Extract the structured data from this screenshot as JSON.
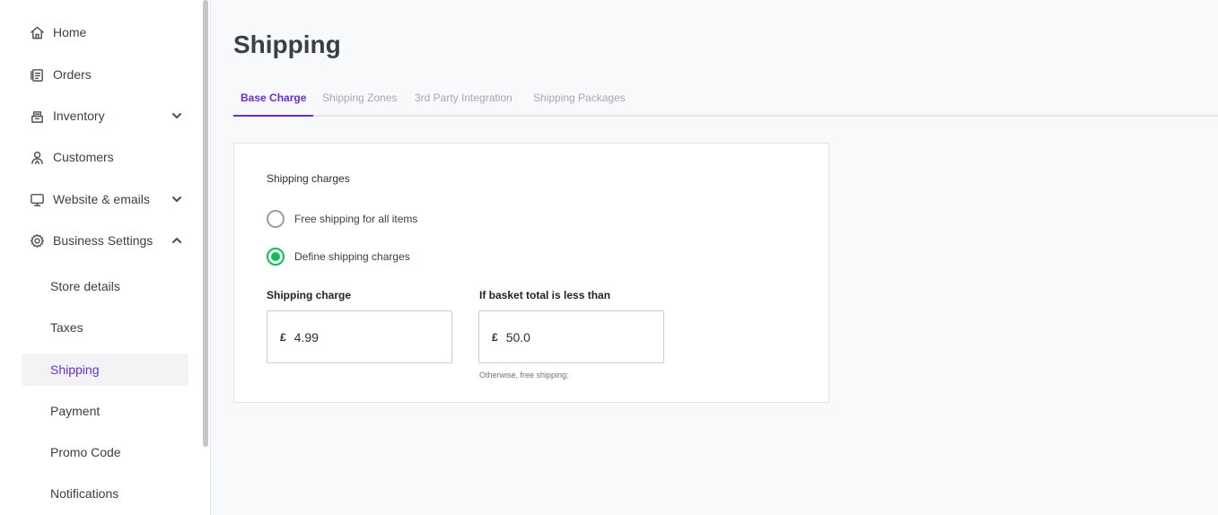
{
  "sidebar": {
    "items": [
      {
        "label": "Home",
        "icon": "home-icon"
      },
      {
        "label": "Orders",
        "icon": "orders-icon"
      },
      {
        "label": "Inventory",
        "icon": "inventory-icon"
      },
      {
        "label": "Customers",
        "icon": "customers-icon"
      },
      {
        "label": "Website & emails",
        "icon": "monitor-icon"
      },
      {
        "label": "Business Settings",
        "icon": "gear-icon"
      }
    ],
    "sub_items": [
      {
        "label": "Store details"
      },
      {
        "label": "Taxes"
      },
      {
        "label": "Shipping",
        "active": true
      },
      {
        "label": "Payment"
      },
      {
        "label": "Promo Code"
      },
      {
        "label": "Notifications"
      }
    ]
  },
  "page": {
    "title": "Shipping"
  },
  "tabs": [
    {
      "label": "Base Charge",
      "active": true
    },
    {
      "label": "Shipping Zones"
    },
    {
      "label": "3rd Party Integration"
    },
    {
      "label": "Shipping Packages"
    }
  ],
  "card": {
    "section_label": "Shipping charges",
    "options": [
      {
        "label": "Free shipping for all items",
        "selected": false
      },
      {
        "label": "Define shipping charges",
        "selected": true
      }
    ],
    "shipping_charge": {
      "label": "Shipping charge",
      "currency": "£",
      "value": "4.99"
    },
    "basket_threshold": {
      "label": "If basket total is less than",
      "currency": "£",
      "value": "50.0"
    },
    "hint": "Otherwise, free shipping;"
  },
  "colors": {
    "accent": "#6a2cd6",
    "radio_selected": "#0bbf56"
  }
}
